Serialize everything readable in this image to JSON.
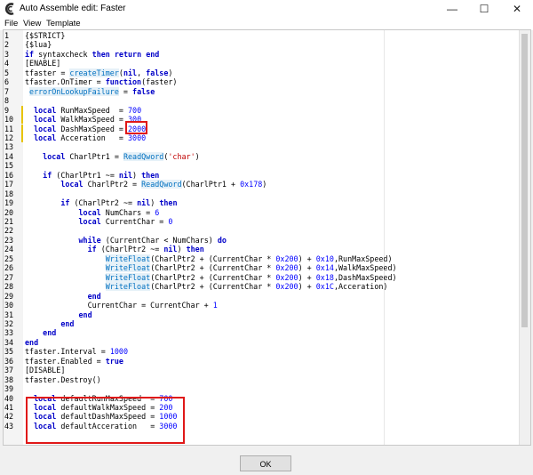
{
  "window": {
    "title": "Auto Assemble edit: Faster",
    "minimize_glyph": "—",
    "maximize_glyph": "☐",
    "close_glyph": "✕"
  },
  "menu": [
    {
      "label": "File"
    },
    {
      "label": "View"
    },
    {
      "label": "Template"
    }
  ],
  "editor": {
    "lines": [
      {
        "n": "1",
        "c": "{$STRICT}"
      },
      {
        "n": "2",
        "c": "{$lua}"
      },
      {
        "n": "3",
        "c": "if syntaxcheck then return end"
      },
      {
        "n": "4",
        "c": "[ENABLE]"
      },
      {
        "n": "5",
        "c": "tfaster = createTimer(nil, false)"
      },
      {
        "n": "6",
        "c": "tfaster.OnTimer = function(faster)"
      },
      {
        "n": "7",
        "c": " errorOnLookupFailure = false"
      },
      {
        "n": "8",
        "c": ""
      },
      {
        "n": "9",
        "c": "  local RunMaxSpeed  = 700"
      },
      {
        "n": "10",
        "c": "  local WalkMaxSpeed = 300"
      },
      {
        "n": "11",
        "c": "  local DashMaxSpeed = 2000"
      },
      {
        "n": "12",
        "c": "  local Acceration   = 3000"
      },
      {
        "n": "13",
        "c": ""
      },
      {
        "n": "14",
        "c": "    local CharlPtr1 = ReadQword('char')"
      },
      {
        "n": "15",
        "c": ""
      },
      {
        "n": "16",
        "c": "    if (CharlPtr1 ~= nil) then"
      },
      {
        "n": "17",
        "c": "        local CharlPtr2 = ReadQword(CharlPtr1 + 0x178)"
      },
      {
        "n": "18",
        "c": ""
      },
      {
        "n": "19",
        "c": "        if (CharlPtr2 ~= nil) then"
      },
      {
        "n": "20",
        "c": "            local NumChars = 6"
      },
      {
        "n": "21",
        "c": "            local CurrentChar = 0"
      },
      {
        "n": "22",
        "c": ""
      },
      {
        "n": "23",
        "c": "            while (CurrentChar < NumChars) do"
      },
      {
        "n": "24",
        "c": "              if (CharlPtr2 ~= nil) then"
      },
      {
        "n": "25",
        "c": "                  WriteFloat(CharlPtr2 + (CurrentChar * 0x200) + 0x10,RunMaxSpeed)"
      },
      {
        "n": "26",
        "c": "                  WriteFloat(CharlPtr2 + (CurrentChar * 0x200) + 0x14,WalkMaxSpeed)"
      },
      {
        "n": "27",
        "c": "                  WriteFloat(CharlPtr2 + (CurrentChar * 0x200) + 0x18,DashMaxSpeed)"
      },
      {
        "n": "28",
        "c": "                  WriteFloat(CharlPtr2 + (CurrentChar * 0x200) + 0x1C,Acceration)"
      },
      {
        "n": "29",
        "c": "              end"
      },
      {
        "n": "30",
        "c": "              CurrentChar = CurrentChar + 1"
      },
      {
        "n": "31",
        "c": "            end"
      },
      {
        "n": "32",
        "c": "        end"
      },
      {
        "n": "33",
        "c": "    end"
      },
      {
        "n": "34",
        "c": "end"
      },
      {
        "n": "35",
        "c": "tfaster.Interval = 1000"
      },
      {
        "n": "36",
        "c": "tfaster.Enabled = true"
      },
      {
        "n": "37",
        "c": "[DISABLE]"
      },
      {
        "n": "38",
        "c": "tfaster.Destroy()"
      },
      {
        "n": "39",
        "c": ""
      },
      {
        "n": "40",
        "c": "  local defaultRunMaxSpeed  = 700"
      },
      {
        "n": "41",
        "c": "  local defaultWalkMaxSpeed = 200"
      },
      {
        "n": "42",
        "c": "  local defaultDashMaxSpeed = 1000"
      },
      {
        "n": "43",
        "c": "  local defaultAcceration   = 3000"
      }
    ]
  },
  "footer": {
    "ok_label": "OK"
  },
  "colors": {
    "keyword": "#0000c8",
    "function": "#0070c0",
    "number": "#0000ff",
    "string": "#c00000",
    "highlight_box": "#e01818",
    "changed_marker": "#e8c400"
  }
}
